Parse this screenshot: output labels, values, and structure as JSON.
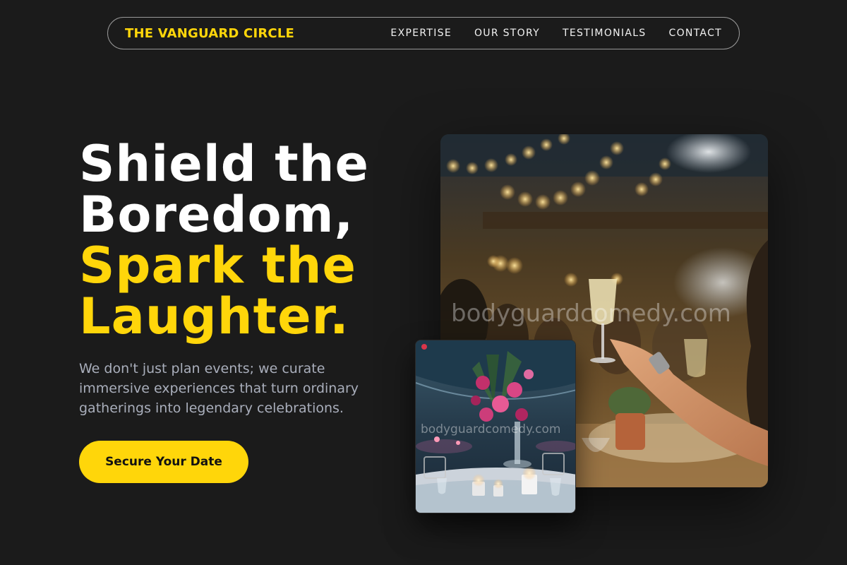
{
  "nav": {
    "brand": "THE VANGUARD CIRCLE",
    "links": [
      "EXPERTISE",
      "OUR STORY",
      "TESTIMONIALS",
      "CONTACT"
    ]
  },
  "hero": {
    "title_lines": [
      "Shield the",
      "Boredom,"
    ],
    "accent_lines": [
      "Spark the",
      "Laughter."
    ],
    "subtitle": "We don't just plan events; we curate immersive experiences that turn ordinary gatherings into legendary celebrations.",
    "cta_label": "Secure Your Date"
  },
  "images": {
    "main_watermark": "bodyguardcomedy.com",
    "inset_watermark": "bodyguardcomedy.com"
  },
  "colors": {
    "background": "#1b1b1b",
    "accent": "#ffd60a",
    "subtitle": "#a9aebb"
  }
}
